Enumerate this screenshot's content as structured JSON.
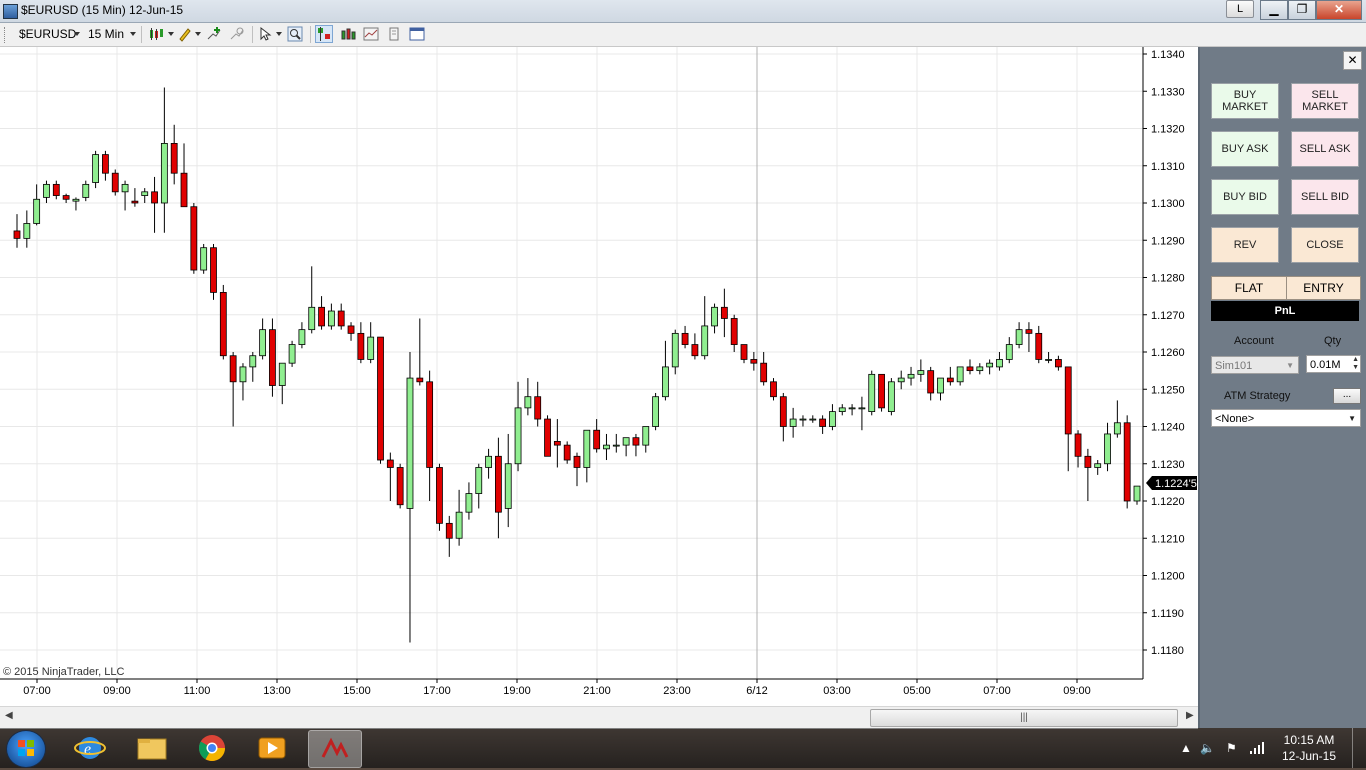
{
  "window": {
    "title": "$EURUSD (15 Min)  12-Jun-15",
    "l_button": "L",
    "min": "▁",
    "max": "❐",
    "close": "✕"
  },
  "toolbar": {
    "instrument": "$EURUSD",
    "interval": "15 Min"
  },
  "chart": {
    "copyright": "© 2015 NinjaTrader, LLC",
    "current_price_label": "1.1224'5",
    "y_ticks": [
      "1.1340",
      "1.1330",
      "1.1320",
      "1.1310",
      "1.1300",
      "1.1290",
      "1.1280",
      "1.1270",
      "1.1260",
      "1.1250",
      "1.1240",
      "1.1230",
      "1.1220",
      "1.1210",
      "1.1200",
      "1.1190",
      "1.1180"
    ],
    "x_ticks": [
      "07:00",
      "09:00",
      "11:00",
      "13:00",
      "15:00",
      "17:00",
      "19:00",
      "21:00",
      "23:00",
      "6/12",
      "03:00",
      "05:00",
      "07:00",
      "09:00"
    ],
    "colors": {
      "up": "#90ee90",
      "down": "#e00000",
      "grid": "#e8e8e8"
    }
  },
  "chart_data": {
    "type": "candlestick",
    "ylim": [
      1.1175,
      1.1342
    ],
    "candles": [
      [
        1.12925,
        1.1297,
        1.1288,
        1.12905
      ],
      [
        1.12905,
        1.1298,
        1.1288,
        1.12945
      ],
      [
        1.12945,
        1.1305,
        1.1294,
        1.1301
      ],
      [
        1.13015,
        1.1306,
        1.13,
        1.1305
      ],
      [
        1.1305,
        1.1306,
        1.1301,
        1.1302
      ],
      [
        1.1302,
        1.13025,
        1.13,
        1.1301
      ],
      [
        1.13005,
        1.13015,
        1.1298,
        1.1301
      ],
      [
        1.13015,
        1.1306,
        1.13005,
        1.1305
      ],
      [
        1.13055,
        1.1314,
        1.1304,
        1.1313
      ],
      [
        1.1313,
        1.1314,
        1.1306,
        1.1308
      ],
      [
        1.1308,
        1.1309,
        1.1302,
        1.1303
      ],
      [
        1.1303,
        1.1306,
        1.1298,
        1.1305
      ],
      [
        1.13005,
        1.1304,
        1.1299,
        1.13
      ],
      [
        1.1302,
        1.1304,
        1.13,
        1.1303
      ],
      [
        1.1303,
        1.1307,
        1.1292,
        1.13
      ],
      [
        1.13,
        1.1331,
        1.1292,
        1.1316
      ],
      [
        1.1316,
        1.1321,
        1.1305,
        1.1308
      ],
      [
        1.1308,
        1.1316,
        1.1299,
        1.1299
      ],
      [
        1.1299,
        1.13,
        1.1281,
        1.1282
      ],
      [
        1.1282,
        1.1289,
        1.1281,
        1.1288
      ],
      [
        1.1288,
        1.1289,
        1.1274,
        1.1276
      ],
      [
        1.1276,
        1.1278,
        1.1258,
        1.1259
      ],
      [
        1.1259,
        1.126,
        1.124,
        1.1252
      ],
      [
        1.1252,
        1.1257,
        1.1247,
        1.1256
      ],
      [
        1.1256,
        1.126,
        1.1252,
        1.1259
      ],
      [
        1.1259,
        1.1269,
        1.1258,
        1.1266
      ],
      [
        1.1266,
        1.1269,
        1.1248,
        1.1251
      ],
      [
        1.1251,
        1.1257,
        1.1246,
        1.1257
      ],
      [
        1.1257,
        1.1263,
        1.1256,
        1.1262
      ],
      [
        1.1262,
        1.1268,
        1.1261,
        1.1266
      ],
      [
        1.1266,
        1.1283,
        1.1265,
        1.1272
      ],
      [
        1.1272,
        1.1275,
        1.1266,
        1.1267
      ],
      [
        1.1267,
        1.1273,
        1.1266,
        1.1271
      ],
      [
        1.1271,
        1.1273,
        1.1266,
        1.1267
      ],
      [
        1.1267,
        1.1268,
        1.1263,
        1.1265
      ],
      [
        1.1265,
        1.1268,
        1.1257,
        1.1258
      ],
      [
        1.1258,
        1.1268,
        1.1257,
        1.1264
      ],
      [
        1.1264,
        1.1264,
        1.123,
        1.1231
      ],
      [
        1.1231,
        1.1233,
        1.122,
        1.1229
      ],
      [
        1.1229,
        1.123,
        1.1218,
        1.1219
      ],
      [
        1.1218,
        1.126,
        1.1182,
        1.1253
      ],
      [
        1.1253,
        1.1269,
        1.1251,
        1.1252
      ],
      [
        1.1252,
        1.1255,
        1.122,
        1.1229
      ],
      [
        1.1229,
        1.123,
        1.1212,
        1.1214
      ],
      [
        1.1214,
        1.1216,
        1.1205,
        1.121
      ],
      [
        1.121,
        1.1223,
        1.1208,
        1.1217
      ],
      [
        1.1217,
        1.1225,
        1.1215,
        1.1222
      ],
      [
        1.1222,
        1.123,
        1.1218,
        1.1229
      ],
      [
        1.1229,
        1.1234,
        1.1226,
        1.1232
      ],
      [
        1.1232,
        1.1237,
        1.121,
        1.1217
      ],
      [
        1.1218,
        1.1238,
        1.1213,
        1.123
      ],
      [
        1.123,
        1.1252,
        1.1228,
        1.1245
      ],
      [
        1.1245,
        1.1253,
        1.1243,
        1.1248
      ],
      [
        1.1248,
        1.1252,
        1.124,
        1.1242
      ],
      [
        1.1242,
        1.1243,
        1.1232,
        1.1232
      ],
      [
        1.1236,
        1.1242,
        1.1229,
        1.1235
      ],
      [
        1.1235,
        1.1236,
        1.123,
        1.1231
      ],
      [
        1.1232,
        1.1233,
        1.1224,
        1.1229
      ],
      [
        1.1229,
        1.1239,
        1.1225,
        1.1239
      ],
      [
        1.1239,
        1.1242,
        1.1233,
        1.1234
      ],
      [
        1.1234,
        1.1238,
        1.1231,
        1.1235
      ],
      [
        1.1235,
        1.1238,
        1.1233,
        1.1235
      ],
      [
        1.1235,
        1.1236,
        1.1232,
        1.1237
      ],
      [
        1.1237,
        1.1238,
        1.1232,
        1.1235
      ],
      [
        1.1235,
        1.124,
        1.1233,
        1.124
      ],
      [
        1.124,
        1.1249,
        1.1239,
        1.1248
      ],
      [
        1.1248,
        1.1263,
        1.1247,
        1.1256
      ],
      [
        1.1256,
        1.1266,
        1.1254,
        1.1265
      ],
      [
        1.1265,
        1.1267,
        1.1261,
        1.1262
      ],
      [
        1.1262,
        1.1265,
        1.1258,
        1.1259
      ],
      [
        1.1259,
        1.1275,
        1.1258,
        1.1267
      ],
      [
        1.1267,
        1.1273,
        1.1265,
        1.1272
      ],
      [
        1.1272,
        1.1277,
        1.1264,
        1.1269
      ],
      [
        1.1269,
        1.127,
        1.126,
        1.1262
      ],
      [
        1.1262,
        1.1262,
        1.1257,
        1.1258
      ],
      [
        1.1258,
        1.126,
        1.1255,
        1.1257
      ],
      [
        1.1257,
        1.126,
        1.1251,
        1.1252
      ],
      [
        1.1252,
        1.1253,
        1.1247,
        1.1248
      ],
      [
        1.1248,
        1.1249,
        1.1236,
        1.124
      ],
      [
        1.124,
        1.1245,
        1.1237,
        1.1242
      ],
      [
        1.1242,
        1.1243,
        1.124,
        1.1242
      ],
      [
        1.1242,
        1.1243,
        1.1241,
        1.1242
      ],
      [
        1.1242,
        1.1243,
        1.1238,
        1.124
      ],
      [
        1.124,
        1.1246,
        1.1239,
        1.1244
      ],
      [
        1.1244,
        1.1246,
        1.1243,
        1.1245
      ],
      [
        1.1245,
        1.1246,
        1.1243,
        1.1245
      ],
      [
        1.1245,
        1.1248,
        1.1239,
        1.1245
      ],
      [
        1.1244,
        1.1255,
        1.1243,
        1.1254
      ],
      [
        1.1254,
        1.1254,
        1.1244,
        1.1245
      ],
      [
        1.1244,
        1.1253,
        1.1243,
        1.1252
      ],
      [
        1.1252,
        1.1255,
        1.125,
        1.1253
      ],
      [
        1.1253,
        1.1256,
        1.1251,
        1.1254
      ],
      [
        1.1254,
        1.1258,
        1.1252,
        1.1255
      ],
      [
        1.1255,
        1.1256,
        1.1247,
        1.1249
      ],
      [
        1.1249,
        1.1253,
        1.1247,
        1.1253
      ],
      [
        1.1253,
        1.1256,
        1.1251,
        1.1252
      ],
      [
        1.1252,
        1.1256,
        1.1251,
        1.1256
      ],
      [
        1.1256,
        1.1258,
        1.1254,
        1.1255
      ],
      [
        1.1255,
        1.1257,
        1.1254,
        1.1256
      ],
      [
        1.1256,
        1.1258,
        1.1254,
        1.1257
      ],
      [
        1.1256,
        1.126,
        1.1255,
        1.1258
      ],
      [
        1.1258,
        1.1264,
        1.1257,
        1.1262
      ],
      [
        1.1262,
        1.1268,
        1.1261,
        1.1266
      ],
      [
        1.1266,
        1.1268,
        1.126,
        1.1265
      ],
      [
        1.1265,
        1.1267,
        1.1257,
        1.1258
      ],
      [
        1.1258,
        1.126,
        1.1257,
        1.1258
      ],
      [
        1.1258,
        1.1259,
        1.1255,
        1.1256
      ],
      [
        1.1256,
        1.1256,
        1.1228,
        1.1238
      ],
      [
        1.1238,
        1.1239,
        1.1229,
        1.1232
      ],
      [
        1.1232,
        1.1234,
        1.122,
        1.1229
      ],
      [
        1.1229,
        1.1231,
        1.1227,
        1.123
      ],
      [
        1.123,
        1.1241,
        1.1228,
        1.1238
      ],
      [
        1.1238,
        1.1247,
        1.1237,
        1.1241
      ],
      [
        1.1241,
        1.1243,
        1.1218,
        1.122
      ],
      [
        1.122,
        1.1224,
        1.1219,
        1.1224
      ]
    ]
  },
  "panel": {
    "close_x": "✕",
    "buy_market": "BUY\nMARKET",
    "sell_market": "SELL\nMARKET",
    "buy_ask": "BUY ASK",
    "sell_ask": "SELL ASK",
    "buy_bid": "BUY BID",
    "sell_bid": "SELL BID",
    "rev": "REV",
    "close": "CLOSE",
    "flat": "FLAT",
    "entry": "ENTRY",
    "pnl": "PnL",
    "account_label": "Account",
    "qty_label": "Qty",
    "account_value": "Sim101",
    "qty_value": "0.01M",
    "atm_label": "ATM Strategy",
    "atm_btn": "...",
    "atm_value": "<None>"
  },
  "taskbar": {
    "time": "10:15 AM",
    "date": "12-Jun-15"
  }
}
